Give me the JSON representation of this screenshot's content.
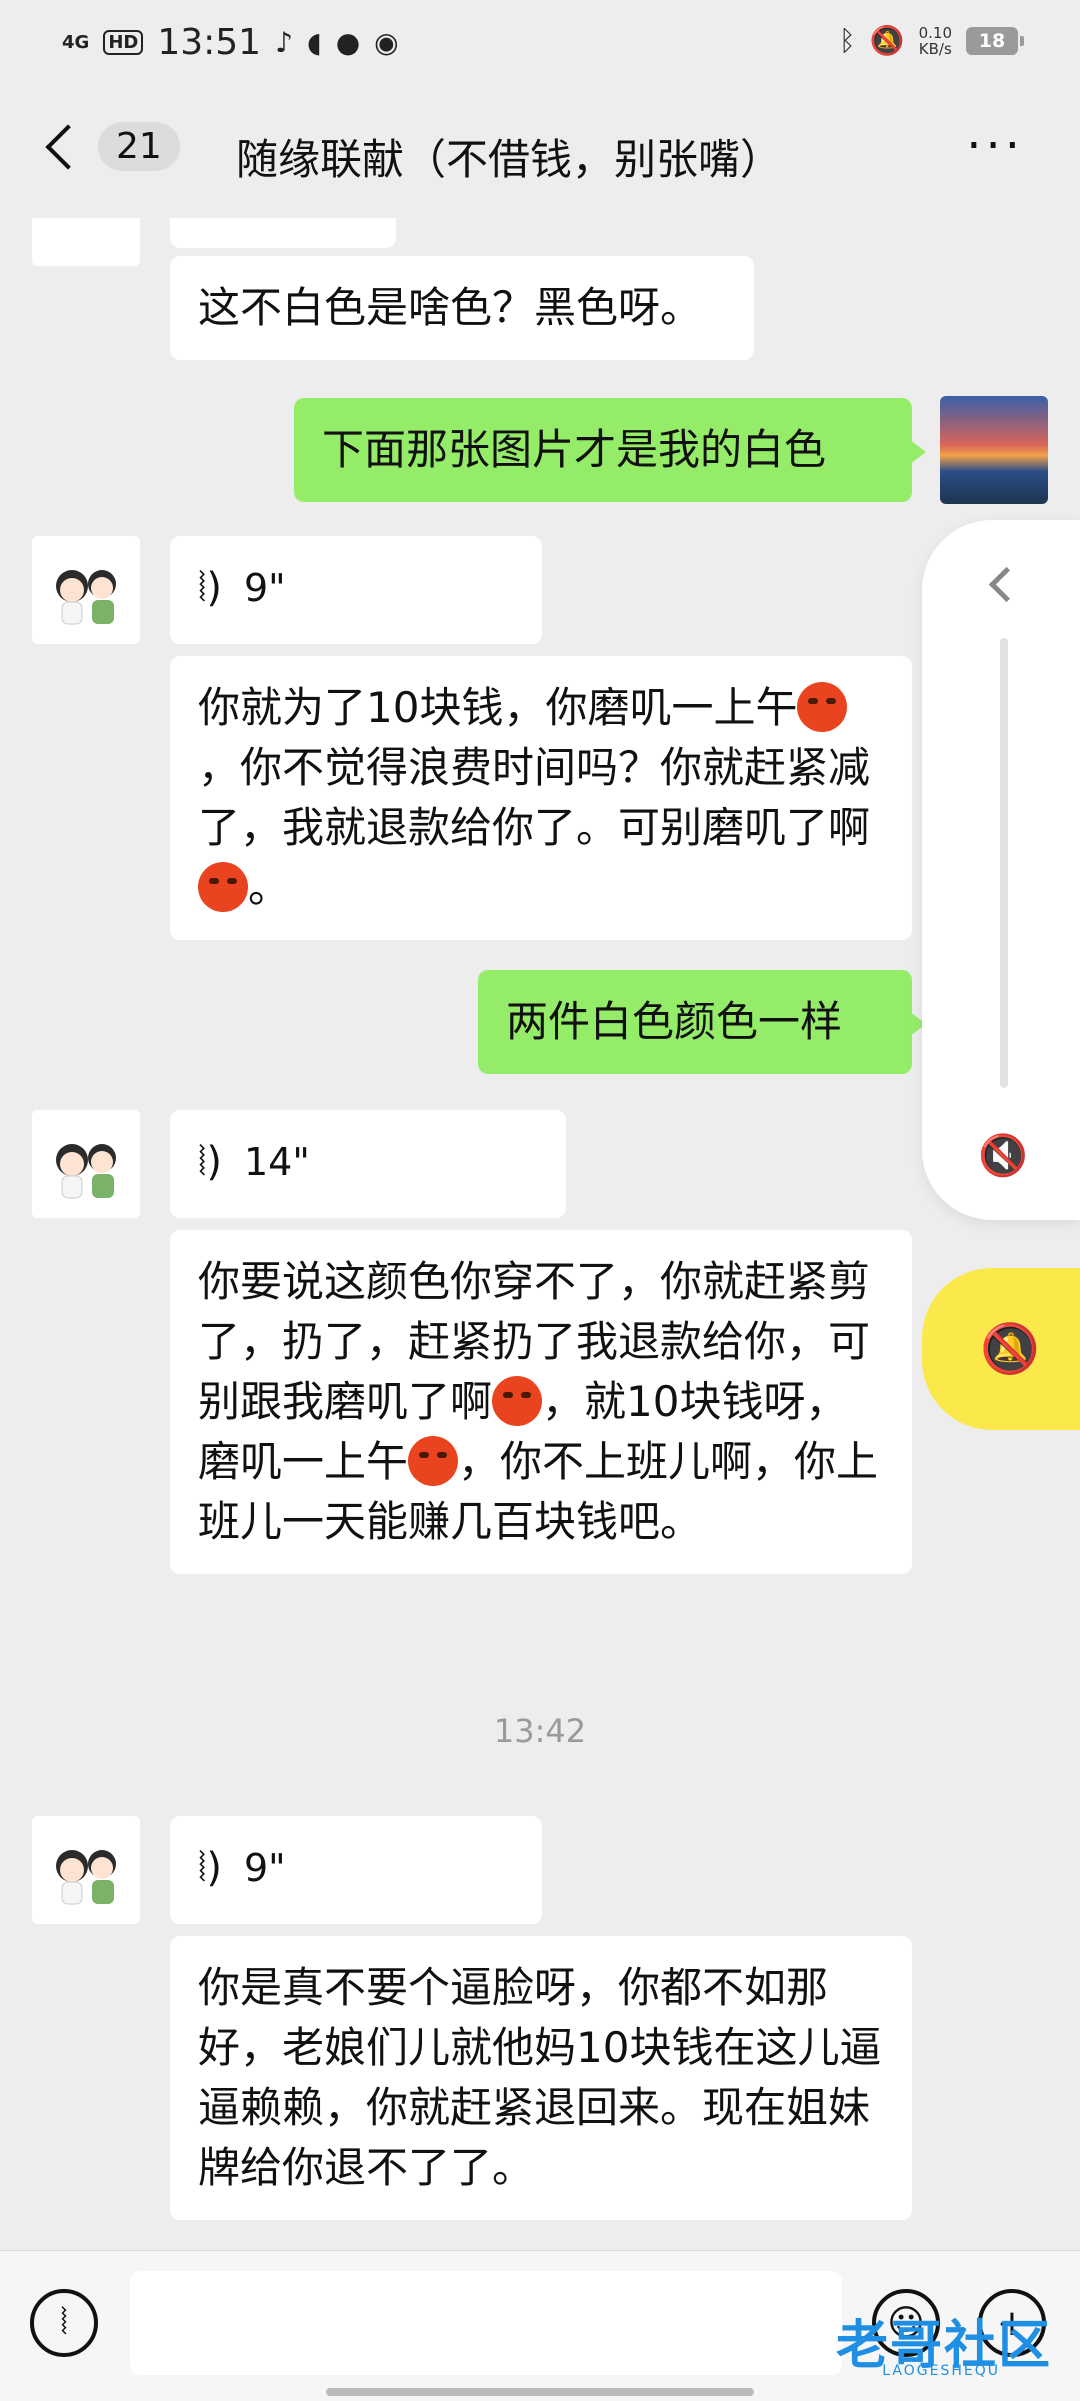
{
  "status_bar": {
    "network": "4G",
    "hd": "HD",
    "time": "13:51",
    "speed_value": "0.10",
    "speed_unit": "KB/s",
    "battery": "18"
  },
  "header": {
    "unread_count": "21",
    "title": "随缘联献（不借钱，别张嘴）",
    "more_label": "···"
  },
  "messages": [
    {
      "side": "left",
      "type": "text",
      "text": "这不白色是啥色？黑色呀。"
    },
    {
      "side": "right",
      "type": "text",
      "text": "下面那张图片才是我的白色"
    },
    {
      "side": "left",
      "type": "voice",
      "duration": "9\""
    },
    {
      "side": "left",
      "type": "text",
      "text_parts": [
        "你就为了10块钱，你磨叽一上午",
        "，你不觉得浪费时间吗？你就赶紧减了，我就退款给你了。可别磨叽了啊",
        "。"
      ]
    },
    {
      "side": "right",
      "type": "text",
      "text": "两件白色颜色一样"
    },
    {
      "side": "left",
      "type": "voice",
      "duration": "14\""
    },
    {
      "side": "left",
      "type": "text",
      "text_parts": [
        "你要说这颜色你穿不了，你就赶紧剪了，扔了，赶紧扔了我退款给你，可别跟我磨叽了啊",
        "，就10块钱呀，磨叽一上午",
        "，你不上班儿啊，你上班儿一天能赚几百块钱吧。"
      ]
    },
    {
      "side": "center",
      "type": "timestamp",
      "text": "13:42"
    },
    {
      "side": "left",
      "type": "voice",
      "duration": "9\""
    },
    {
      "side": "left",
      "type": "text",
      "text": "你是真不要个逼脸呀，你都不如那好，老娘们儿就他妈10块钱在这儿逼逼赖赖，你就赶紧退回来。现在姐妹牌给你退不了了。"
    }
  ],
  "input_bar": {
    "voice_icon": "voice-icon",
    "emoji_icon": "emoji-icon",
    "plus_icon": "plus-icon"
  },
  "watermark": {
    "main": "老哥社区",
    "sub": "LAOGESHEQU"
  },
  "colors": {
    "background": "#ededed",
    "my_bubble": "#95ec69",
    "their_bubble": "#ffffff",
    "float_button": "#fbe94b"
  }
}
